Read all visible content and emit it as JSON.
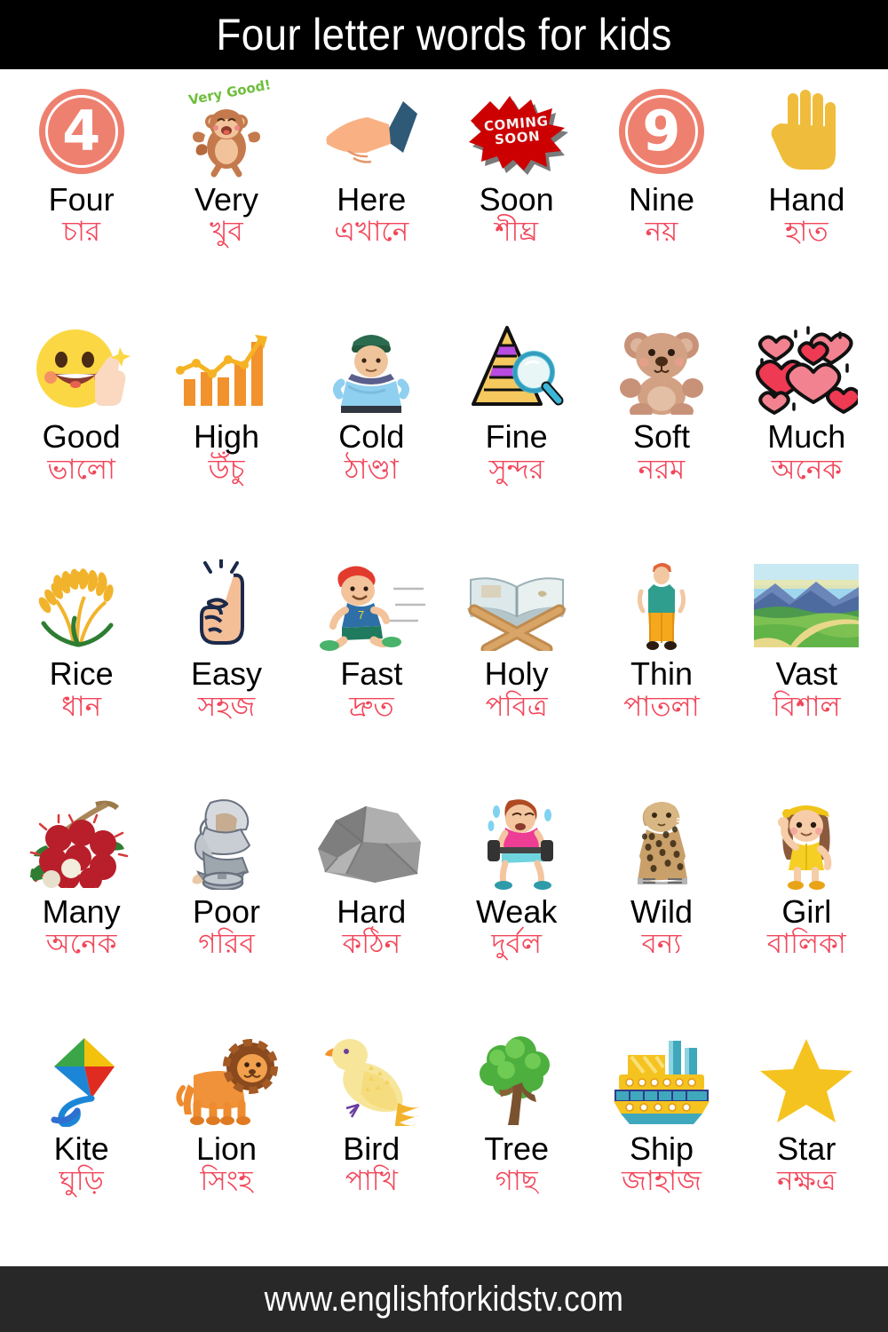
{
  "header": {
    "title": "Four letter words for kids",
    "background": "#000000",
    "text_color": "#ffffff"
  },
  "footer": {
    "url": "www.englishforkidstv.com",
    "background": "#282828",
    "text_color": "#ffffff"
  },
  "colors": {
    "english_word": "#000000",
    "bengali_word": "#F2465A",
    "badge_salmon": "#EE8070",
    "soon_red": "#CC0000",
    "very_good_green": "#6EBF3C"
  },
  "inline_labels": {
    "very_good": "Very Good!",
    "coming_soon_line1": "Coming",
    "coming_soon_line2": "Soon",
    "number_four": "৪",
    "number_nine": "৯"
  },
  "grid": {
    "columns": 6,
    "rows": 5
  },
  "items": [
    {
      "en": "Four",
      "bn": "চার",
      "icon": "number-four-badge-icon"
    },
    {
      "en": "Very",
      "bn": "খুব",
      "icon": "monkey-very-good-icon"
    },
    {
      "en": "Here",
      "bn": "এখানে",
      "icon": "pointing-hand-icon"
    },
    {
      "en": "Soon",
      "bn": "শীঘ্র",
      "icon": "coming-soon-burst-icon"
    },
    {
      "en": "Nine",
      "bn": "নয়",
      "icon": "number-nine-badge-icon"
    },
    {
      "en": "Hand",
      "bn": "হাত",
      "icon": "raised-hand-icon"
    },
    {
      "en": "Good",
      "bn": "ভালো",
      "icon": "smiley-thumbs-up-icon"
    },
    {
      "en": "High",
      "bn": "উঁচু",
      "icon": "rising-bar-chart-icon"
    },
    {
      "en": "Cold",
      "bn": "ঠাণ্ডা",
      "icon": "shivering-person-icon"
    },
    {
      "en": "Fine",
      "bn": "সুন্দর",
      "icon": "pyramid-magnifier-icon"
    },
    {
      "en": "Soft",
      "bn": "নরম",
      "icon": "teddy-bear-icon"
    },
    {
      "en": "Much",
      "bn": "অনেক",
      "icon": "many-hearts-icon"
    },
    {
      "en": "Rice",
      "bn": "ধান",
      "icon": "rice-stalk-icon"
    },
    {
      "en": "Easy",
      "bn": "সহজ",
      "icon": "snapping-fingers-icon"
    },
    {
      "en": "Fast",
      "bn": "দ্রুত",
      "icon": "running-boy-icon"
    },
    {
      "en": "Holy",
      "bn": "পবিত্র",
      "icon": "holy-book-stand-icon"
    },
    {
      "en": "Thin",
      "bn": "পাতলা",
      "icon": "thin-man-icon"
    },
    {
      "en": "Vast",
      "bn": "বিশাল",
      "icon": "vast-landscape-icon"
    },
    {
      "en": "Many",
      "bn": "অনেক",
      "icon": "pile-of-rambutan-icon"
    },
    {
      "en": "Poor",
      "bn": "গরিব",
      "icon": "poor-beggar-icon"
    },
    {
      "en": "Hard",
      "bn": "কঠিন",
      "icon": "grey-rock-icon"
    },
    {
      "en": "Weak",
      "bn": "দুর্বল",
      "icon": "weak-boy-dumbbell-icon"
    },
    {
      "en": "Wild",
      "bn": "বন্য",
      "icon": "leopard-icon"
    },
    {
      "en": "Girl",
      "bn": "বালিকা",
      "icon": "waving-girl-icon"
    },
    {
      "en": "Kite",
      "bn": "ঘুড়ি",
      "icon": "kite-icon"
    },
    {
      "en": "Lion",
      "bn": "সিংহ",
      "icon": "lion-icon"
    },
    {
      "en": "Bird",
      "bn": "পাখি",
      "icon": "yellow-bird-icon"
    },
    {
      "en": "Tree",
      "bn": "গাছ",
      "icon": "tree-icon"
    },
    {
      "en": "Ship",
      "bn": "জাহাজ",
      "icon": "ship-icon"
    },
    {
      "en": "Star",
      "bn": "নক্ষত্র",
      "icon": "star-icon"
    }
  ]
}
